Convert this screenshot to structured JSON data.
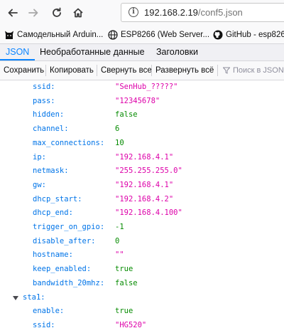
{
  "browser": {
    "url_host": "192.168.2.19",
    "url_path": "/conf5.json"
  },
  "bookmarks": [
    {
      "icon": "github-cat-icon",
      "label": "Самодельный Arduin..."
    },
    {
      "icon": "globe-icon",
      "label": "ESP8266 (Web Server..."
    },
    {
      "icon": "github-icon",
      "label": "GitHub - esp8266"
    }
  ],
  "tabs": [
    {
      "label": "JSON",
      "active": true
    },
    {
      "label": "Необработанные данные",
      "active": false
    },
    {
      "label": "Заголовки",
      "active": false
    }
  ],
  "toolbar": {
    "save": "Сохранить",
    "copy": "Копировать",
    "collapse_all": "Свернуть все",
    "expand_all": "Развернуть всё",
    "filter_placeholder": "Поиск в JSON"
  },
  "json_rows": [
    {
      "key": "ssid:",
      "value": "\"SenHub_?????\"",
      "type": "str"
    },
    {
      "key": "pass:",
      "value": "\"12345678\"",
      "type": "str"
    },
    {
      "key": "hidden:",
      "value": "false",
      "type": "bool"
    },
    {
      "key": "channel:",
      "value": "6",
      "type": "num"
    },
    {
      "key": "max_connections:",
      "value": "10",
      "type": "num"
    },
    {
      "key": "ip:",
      "value": "\"192.168.4.1\"",
      "type": "str"
    },
    {
      "key": "netmask:",
      "value": "\"255.255.255.0\"",
      "type": "str"
    },
    {
      "key": "gw:",
      "value": "\"192.168.4.1\"",
      "type": "str"
    },
    {
      "key": "dhcp_start:",
      "value": "\"192.168.4.2\"",
      "type": "str"
    },
    {
      "key": "dhcp_end:",
      "value": "\"192.168.4.100\"",
      "type": "str"
    },
    {
      "key": "trigger_on_gpio:",
      "value": "-1",
      "type": "num"
    },
    {
      "key": "disable_after:",
      "value": "0",
      "type": "num"
    },
    {
      "key": "hostname:",
      "value": "\"\"",
      "type": "str"
    },
    {
      "key": "keep_enabled:",
      "value": "true",
      "type": "bool"
    },
    {
      "key": "bandwidth_20mhz:",
      "value": "false",
      "type": "bool"
    }
  ],
  "section": {
    "key": "sta1:"
  },
  "section_rows": [
    {
      "key": "enable:",
      "value": "true",
      "type": "bool"
    },
    {
      "key": "ssid:",
      "value": "\"HG520\"",
      "type": "str"
    }
  ]
}
